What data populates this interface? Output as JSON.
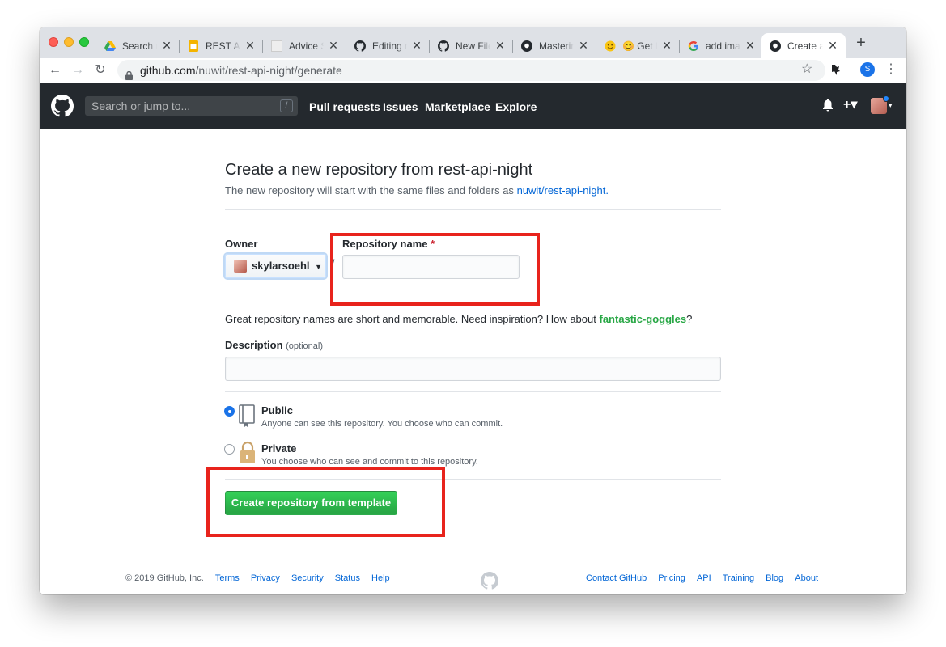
{
  "browser": {
    "tabs": [
      {
        "title": "Search re",
        "icon": "drive-icon"
      },
      {
        "title": "REST API",
        "icon": "slides-icon"
      },
      {
        "title": "Advice Sl",
        "icon": "blank-page-icon"
      },
      {
        "title": "Editing m",
        "icon": "github-icon"
      },
      {
        "title": "New File",
        "icon": "github-icon"
      },
      {
        "title": "Mastering",
        "icon": "github-icon"
      },
      {
        "title": "😊 Get E",
        "icon": "emoji-icon"
      },
      {
        "title": "add imag",
        "icon": "google-icon"
      },
      {
        "title": "Create a",
        "icon": "github-icon",
        "active": true
      }
    ],
    "new_tab_label": "+",
    "url_host": "github.com",
    "url_path": "/nuwit/rest-api-night/generate",
    "profile_initial": "S"
  },
  "gh_header": {
    "search_placeholder": "Search or jump to...",
    "search_shortcut": "/",
    "nav": [
      "Pull requests",
      "Issues",
      "Marketplace",
      "Explore"
    ],
    "plus_label": "+▾"
  },
  "form": {
    "title": "Create a new repository from rest-api-night",
    "subtitle_prefix": "The new repository will start with the same files and folders as",
    "subtitle_link": "nuwit/rest-api-night.",
    "owner_label": "Owner",
    "owner_value": "skylarsoehl",
    "separator": "/",
    "repo_name_label": "Repository name",
    "required_mark": "*",
    "repo_name_value": "",
    "hint_text": "Great repository names are short and memorable. Need inspiration? How about",
    "suggestion": "fantastic-goggles",
    "hint_suffix": "?",
    "description_label": "Description",
    "description_optional": "(optional)",
    "description_value": "",
    "visibility": [
      {
        "title": "Public",
        "desc": "Anyone can see this repository. You choose who can commit.",
        "selected": true
      },
      {
        "title": "Private",
        "desc": "You choose who can see and commit to this repository.",
        "selected": false
      }
    ],
    "submit_label": "Create repository from template"
  },
  "footer": {
    "copyright": "© 2019 GitHub, Inc.",
    "left_links": [
      "Terms",
      "Privacy",
      "Security",
      "Status",
      "Help"
    ],
    "right_links": [
      "Contact GitHub",
      "Pricing",
      "API",
      "Training",
      "Blog",
      "About"
    ]
  },
  "colors": {
    "header_bg": "#24292e",
    "primary_button": "#28a745",
    "link": "#0366d6",
    "annotation_red": "#e8231c"
  }
}
